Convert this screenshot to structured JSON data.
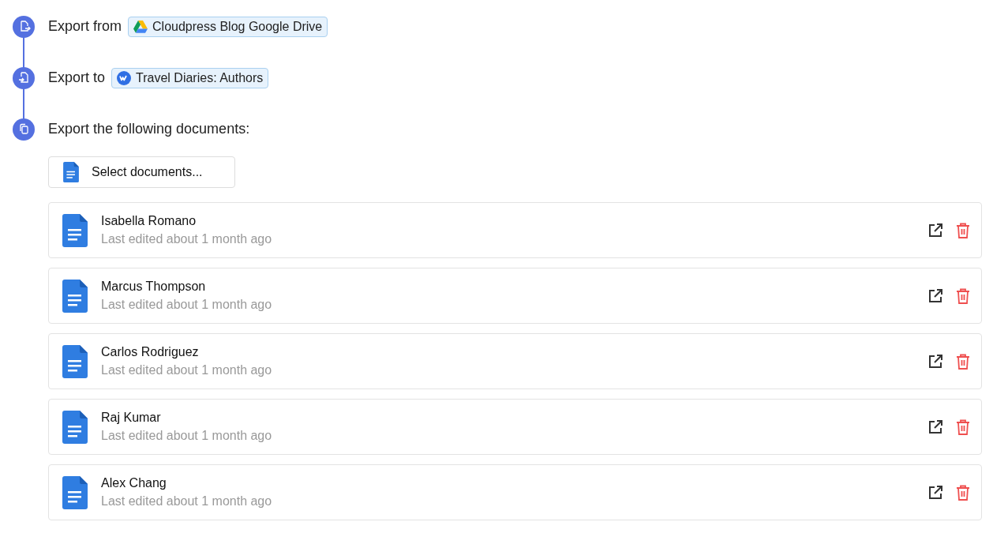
{
  "steps": [
    {
      "label": "Export from",
      "chip": {
        "kind": "drive",
        "label": "Cloudpress Blog Google Drive"
      },
      "kind": "source"
    },
    {
      "label": "Export to",
      "chip": {
        "kind": "webflow",
        "label": "Travel Diaries: Authors"
      },
      "kind": "destination"
    },
    {
      "label": "Export the following documents:",
      "kind": "documents"
    }
  ],
  "select_button": "Select documents...",
  "documents": [
    {
      "title": "Isabella Romano",
      "subtitle": "Last edited about 1 month ago"
    },
    {
      "title": "Marcus Thompson",
      "subtitle": "Last edited about 1 month ago"
    },
    {
      "title": "Carlos Rodriguez",
      "subtitle": "Last edited about 1 month ago"
    },
    {
      "title": "Raj Kumar",
      "subtitle": "Last edited about 1 month ago"
    },
    {
      "title": "Alex Chang",
      "subtitle": "Last edited about 1 month ago"
    }
  ]
}
